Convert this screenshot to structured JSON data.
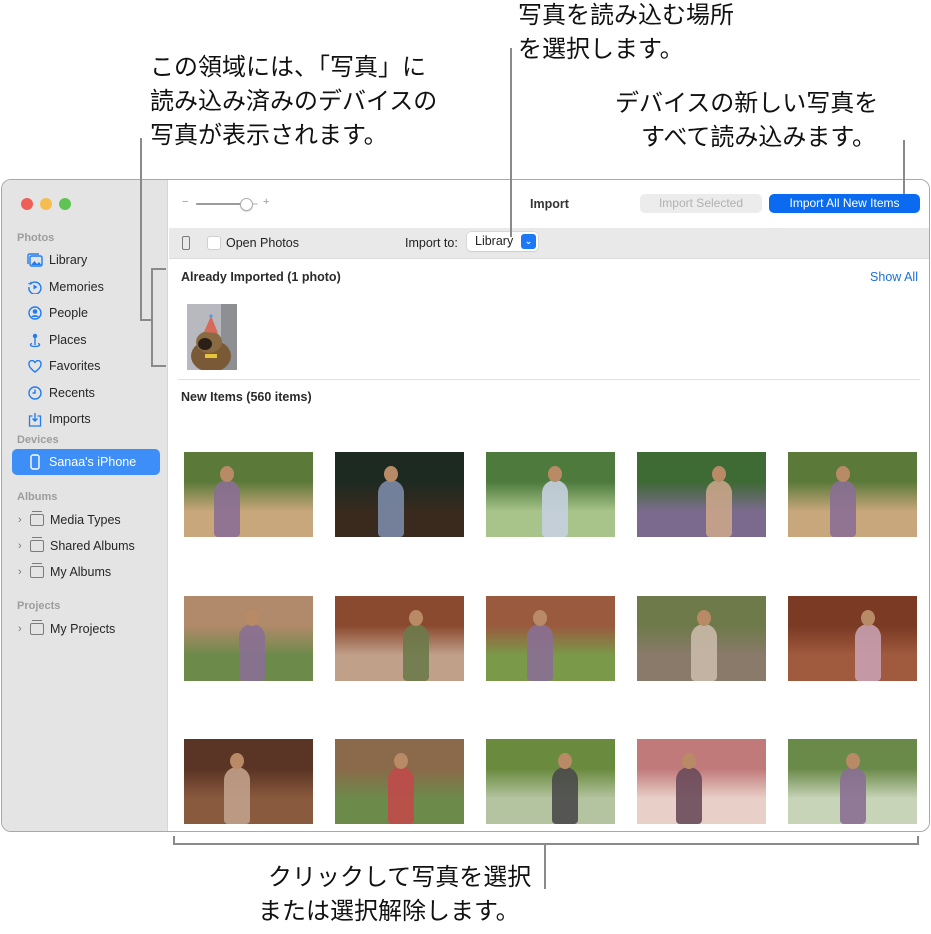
{
  "callouts": {
    "already_imported": [
      "この領域には、「写真」に",
      "読み込み済みのデバイスの",
      "写真が表示されます。"
    ],
    "import_location": [
      "写真を読み込む場所",
      "を選択します。"
    ],
    "import_all": [
      "デバイスの新しい写真を",
      "すべて読み込みます。"
    ],
    "select_photos": [
      "クリックして写真を選択",
      "または選択解除します。"
    ]
  },
  "window": {
    "traffic_lights": {
      "close": "#ed5f57",
      "minimize": "#f5bd4f",
      "zoom": "#5fc454"
    }
  },
  "sidebar": {
    "sections": [
      {
        "heading": "Photos"
      },
      {
        "heading": "Devices"
      },
      {
        "heading": "Albums"
      },
      {
        "heading": "Projects"
      }
    ],
    "photos_items": [
      {
        "label": "Library",
        "icon": "library-icon"
      },
      {
        "label": "Memories",
        "icon": "memories-icon"
      },
      {
        "label": "People",
        "icon": "people-icon"
      },
      {
        "label": "Places",
        "icon": "places-icon"
      },
      {
        "label": "Favorites",
        "icon": "heart-icon"
      },
      {
        "label": "Recents",
        "icon": "clock-icon"
      },
      {
        "label": "Imports",
        "icon": "import-icon"
      }
    ],
    "devices_items": [
      {
        "label": "Sanaa's iPhone",
        "icon": "iphone-icon",
        "selected": true
      }
    ],
    "albums_items": [
      {
        "label": "Media Types",
        "icon": "folder-icon"
      },
      {
        "label": "Shared Albums",
        "icon": "shared-folder-icon"
      },
      {
        "label": "My Albums",
        "icon": "folder-icon"
      }
    ],
    "projects_items": [
      {
        "label": "My Projects",
        "icon": "folder-icon"
      }
    ]
  },
  "toolbar": {
    "zoom_minus": "−",
    "zoom_plus": "+",
    "zoom_level": 0.8,
    "title": "Import",
    "import_selected_label": "Import Selected",
    "import_all_label": "Import All New Items"
  },
  "subbar": {
    "open_photos_label": "Open Photos",
    "open_photos_checked": false,
    "import_to_label": "Import to:",
    "import_to_value": "Library"
  },
  "content": {
    "already_imported_title": "Already Imported (1 photo)",
    "show_all_label": "Show All",
    "new_items_title": "New Items (560 items)",
    "already_imported_photos": [
      {
        "desc": "Dog wearing party hat"
      }
    ],
    "new_items_photos": [
      {
        "desc": "Travelers walking, woman laughing",
        "colors": [
          "#5b7a3a",
          "#c9a77c",
          "#8a6f94"
        ]
      },
      {
        "desc": "Man at chalkboard cafe",
        "colors": [
          "#1d2a22",
          "#3a2a1e",
          "#7b8aa6"
        ]
      },
      {
        "desc": "Man smiling by flowers",
        "colors": [
          "#4e7a3e",
          "#a8c48a",
          "#c7d0e0"
        ]
      },
      {
        "desc": "Woman with backpack laughing",
        "colors": [
          "#3e6a34",
          "#7c6a8e",
          "#c9a58a"
        ]
      },
      {
        "desc": "Travelers walking, woman laughing",
        "colors": [
          "#5b7a3a",
          "#c9a77c",
          "#8a6f94"
        ]
      },
      {
        "desc": "Group at temple ruins",
        "colors": [
          "#b08a6a",
          "#6c8a4a",
          "#8a6f94"
        ]
      },
      {
        "desc": "Friends sitting at brick ruins",
        "colors": [
          "#8a4a30",
          "#c1a08a",
          "#6c7a4a"
        ]
      },
      {
        "desc": "Woman at temple ruins",
        "colors": [
          "#9a5a3e",
          "#7a9a4a",
          "#8a6f94"
        ]
      },
      {
        "desc": "Two travelers by river",
        "colors": [
          "#6e7a4a",
          "#8a7a6a",
          "#c9b9a8"
        ]
      },
      {
        "desc": "Woman in temple doorway",
        "colors": [
          "#7a3a24",
          "#a05a3e",
          "#c8a0b0"
        ]
      },
      {
        "desc": "Two women walking in corridor",
        "colors": [
          "#5a3424",
          "#8a5a3e",
          "#c1a08a"
        ]
      },
      {
        "desc": "Woman by tree with ribbons",
        "colors": [
          "#8a6a4a",
          "#6c8a4a",
          "#c04a4a"
        ]
      },
      {
        "desc": "Friends relaxing on grass",
        "colors": [
          "#6a8a3e",
          "#b4c4a0",
          "#4a4a4a"
        ]
      },
      {
        "desc": "Two women at market",
        "colors": [
          "#c07a7a",
          "#e8d0c8",
          "#6a4a5a"
        ]
      },
      {
        "desc": "Friends cheering with cart",
        "colors": [
          "#6a8a4a",
          "#c8d4b8",
          "#8a6f94"
        ]
      }
    ]
  }
}
